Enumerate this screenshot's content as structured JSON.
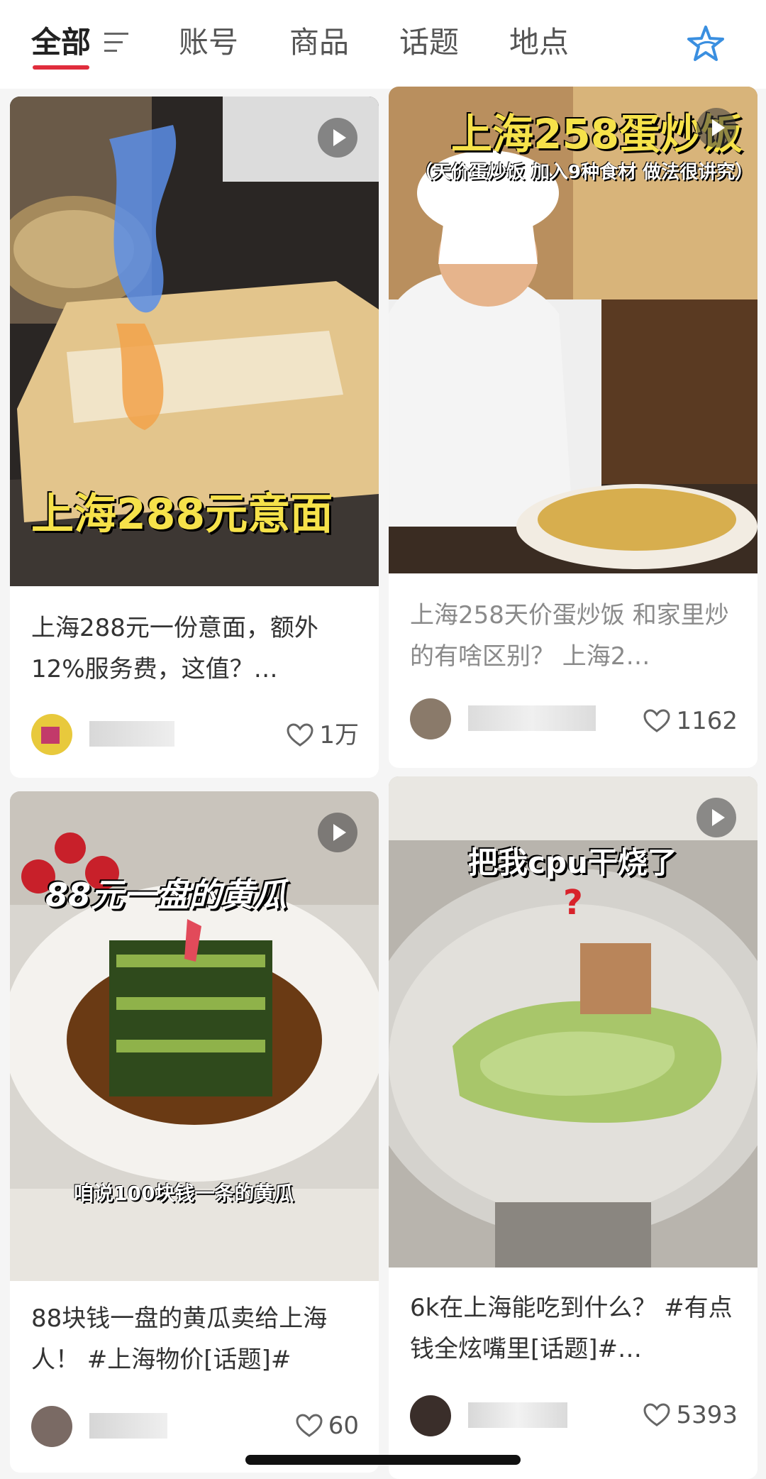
{
  "tabs": [
    "全部",
    "账号",
    "商品",
    "话题",
    "地点"
  ],
  "icons": {
    "filter": "filter-lines-icon",
    "star": "star-icon",
    "play": "play-icon",
    "heart": "heart-outline-icon"
  },
  "colors": {
    "accent": "#e02d3c",
    "star": "#3a8fe0"
  },
  "cards": [
    {
      "overlay_text": "上海288元意面",
      "title": "上海288元一份意面，额外12%服务费，这值？…",
      "likes": "1万",
      "is_video": true
    },
    {
      "overlay_text": "上海258蛋炒饭",
      "overlay_subtext": "（天价蛋炒饭 加入9种食材 做法很讲究）",
      "title": "上海258天价蛋炒饭 和家里炒的有啥区别？ 上海2…",
      "likes": "1162",
      "is_video": true
    },
    {
      "overlay_text": "88元一盘的黄瓜",
      "overlay_subtext": "咱说100块钱一条的黄瓜",
      "title": "88块钱一盘的黄瓜卖给上海人！ #上海物价[话题]#",
      "likes": "60",
      "is_video": true
    },
    {
      "overlay_text": "把我cpu干烧了",
      "overlay_mark": "?",
      "title": "6k在上海能吃到什么？ #有点钱全炫嘴里[话题]#…",
      "likes": "5393",
      "is_video": true
    }
  ]
}
